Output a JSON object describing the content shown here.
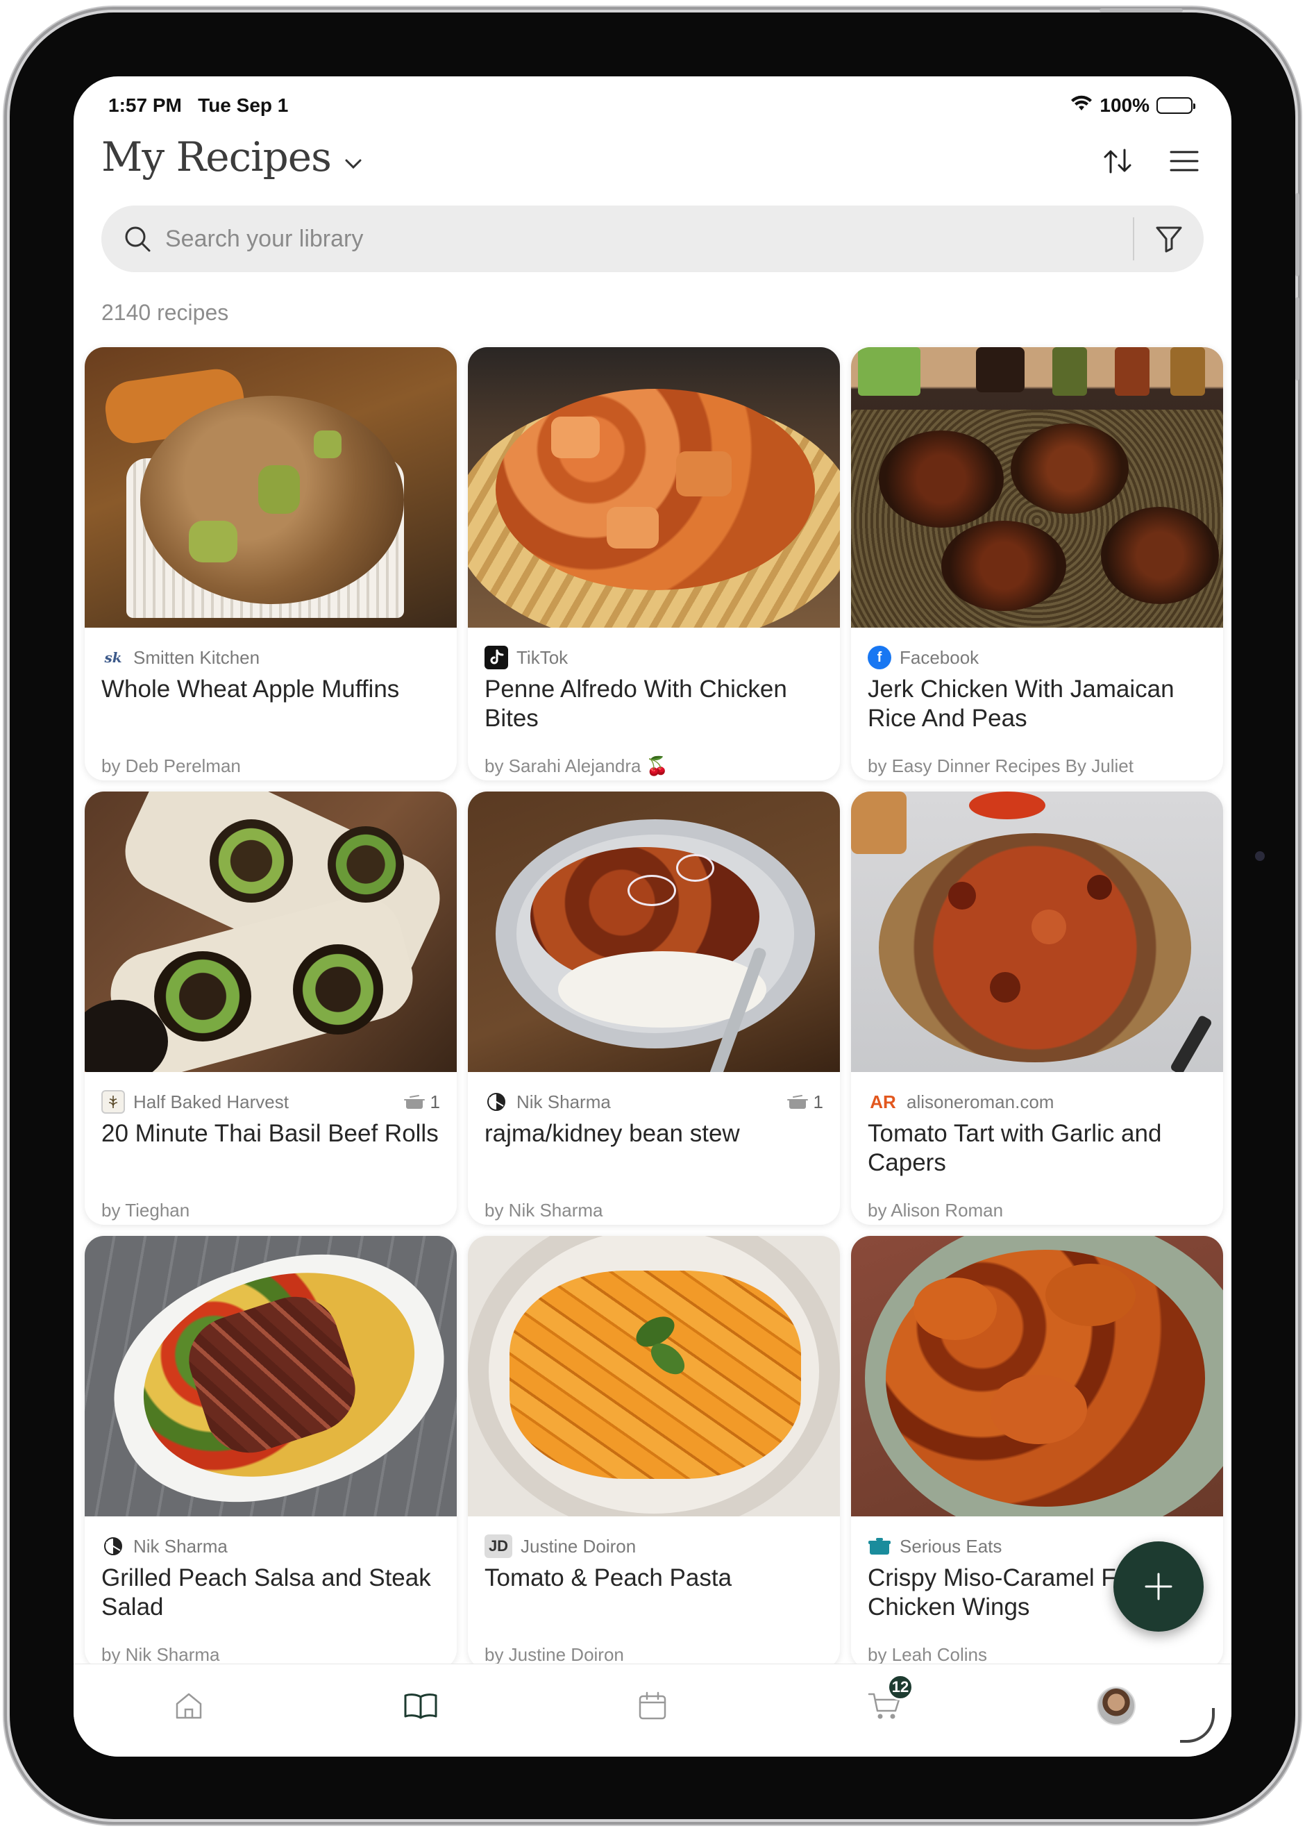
{
  "status": {
    "time": "1:57 PM",
    "date": "Tue Sep 1",
    "battery": "100%"
  },
  "header": {
    "title": "My Recipes"
  },
  "search": {
    "placeholder": "Search your library"
  },
  "library": {
    "count": "2140 recipes"
  },
  "recipes": [
    {
      "source": "Smitten Kitchen",
      "title": "Whole Wheat Apple Muffins",
      "author": "by Deb Perelman",
      "cooked": ""
    },
    {
      "source": "TikTok",
      "title": "Penne Alfredo With Chicken Bites",
      "author": "by Sarahi Alejandra 🍒",
      "cooked": ""
    },
    {
      "source": "Facebook",
      "title": "Jerk Chicken With Jamaican Rice And Peas",
      "author": "by Easy Dinner Recipes By Juliet",
      "cooked": ""
    },
    {
      "source": "Half Baked Harvest",
      "title": "20 Minute Thai Basil Beef Rolls",
      "author": "by Tieghan",
      "cooked": "1"
    },
    {
      "source": "Nik Sharma",
      "title": "rajma/kidney bean stew",
      "author": "by Nik Sharma",
      "cooked": "1"
    },
    {
      "source": "alisoneroman.com",
      "title": "Tomato Tart with Garlic and Capers",
      "author": "by Alison Roman",
      "cooked": ""
    },
    {
      "source": "Nik Sharma",
      "title": "Grilled Peach Salsa and Steak Salad",
      "author": "by Nik Sharma",
      "cooked": ""
    },
    {
      "source": "Justine Doiron",
      "title": "Tomato & Peach Pasta",
      "author": "by Justine Doiron",
      "cooked": ""
    },
    {
      "source": "Serious Eats",
      "title": "Crispy Miso-Caramel Fried Chicken Wings",
      "author": "by Leah Colins",
      "cooked": ""
    }
  ],
  "source_logos": {
    "smitten": "sk",
    "tiktok": "tiktok-icon",
    "facebook": "f",
    "hbh": "hbh-icon",
    "nik": "nik-icon",
    "ar": "AR",
    "jd": "JD",
    "serious": "serious-eats-icon"
  },
  "tabbar": {
    "cart_badge": "12"
  },
  "colors": {
    "accent": "#1d3b30",
    "ar_orange": "#e2571e",
    "facebook_blue": "#1877f2",
    "serious_teal": "#1a8c9c"
  }
}
